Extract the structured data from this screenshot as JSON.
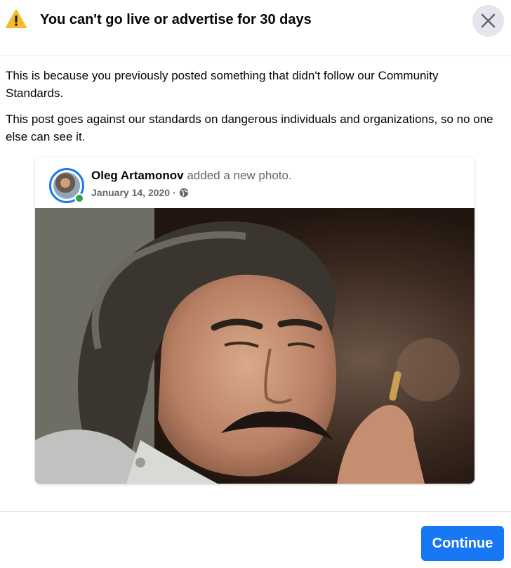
{
  "header": {
    "title": "You can't go live or advertise for 30 days",
    "warning_icon": "warning-icon",
    "close_icon": "close-icon"
  },
  "body": {
    "paragraph1": "This is because you previously posted something that didn't follow our Community Standards.",
    "paragraph2": "This post goes against our standards on dangerous individuals and organizations, so no one else can see it."
  },
  "post": {
    "author": "Oleg Artamonov",
    "action": " added a new photo.",
    "date": "January 14, 2020 ·",
    "privacy_icon": "globe-icon",
    "online": true
  },
  "footer": {
    "continue_label": "Continue"
  },
  "colors": {
    "accent": "#1877f2",
    "warning": "#f7b928",
    "online": "#31a24c",
    "secondary_text": "#65676b"
  }
}
